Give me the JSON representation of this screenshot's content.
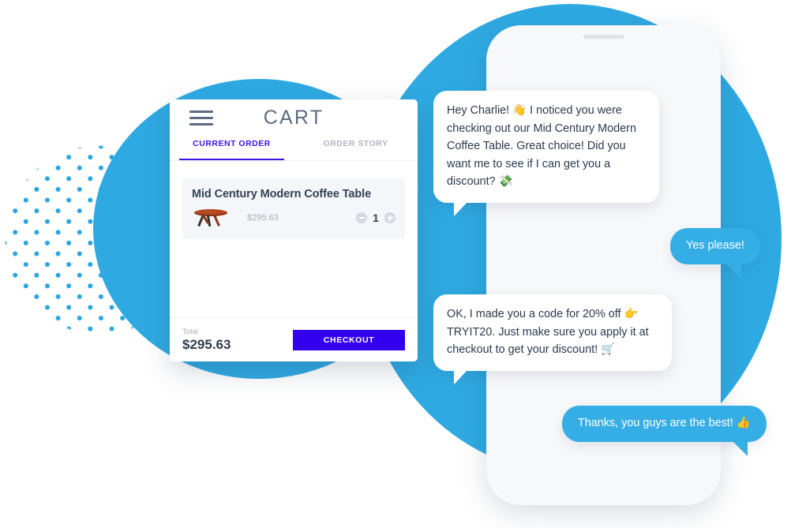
{
  "theme": {
    "blob_blue": "#2FA9E2",
    "bubble_blue": "#35AEE5",
    "accent_violet": "#3D14E8",
    "checkout_violet": "#3300EE",
    "card_white": "#FFFFFF",
    "product_row_bg": "#F4F6F9",
    "phone_body": "#F7F8FA",
    "text_dark": "#2B3A4E",
    "text_muted": "#A6AEBB"
  },
  "cart": {
    "menu_icon": "hamburger-menu-icon",
    "title": "CART",
    "tabs": [
      {
        "label": "CURRENT ORDER",
        "active": true
      },
      {
        "label": "ORDER STORY",
        "active": false
      }
    ],
    "product": {
      "name": "Mid Century Modern Coffee Table",
      "price": "$295.63",
      "quantity": "1",
      "thumbnail_icon": "coffee-table-thumbnail",
      "decrement_icon": "minus-circle-icon",
      "increment_icon": "plus-circle-icon"
    },
    "footer": {
      "total_label": "Total",
      "total_value": "$295.63",
      "checkout_label": "CHECKOUT"
    }
  },
  "phone": {
    "speaker_icon": "phone-speaker-icon",
    "notch_icon": "phone-notch"
  },
  "chat": {
    "messages": [
      {
        "id": "bubble-1",
        "sender": "agent",
        "text": "Hey Charlie! 👋 I noticed you were checking out our Mid Century Modern Coffee Table. Great choice! Did you want me to see if I can get you a discount? 💸"
      },
      {
        "id": "bubble-2",
        "sender": "user",
        "text": "Yes please!"
      },
      {
        "id": "bubble-3",
        "sender": "agent",
        "text": "OK, I made you a code for 20% off 👉 TRYIT20. Just make sure you apply it at checkout to get your discount! 🛒"
      },
      {
        "id": "bubble-4",
        "sender": "user",
        "text": "Thanks, you guys are the best! 👍"
      }
    ]
  },
  "decoration": {
    "dot_pattern": "dotted-circle-pattern",
    "blob_left": "blue-blob-left",
    "blob_right": "blue-blob-right"
  }
}
